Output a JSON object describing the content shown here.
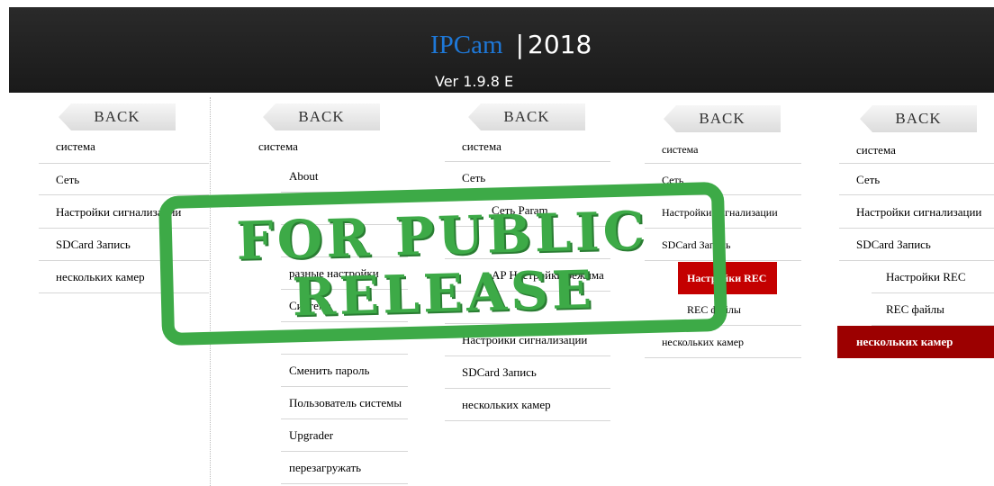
{
  "header": {
    "brand": "IPCam",
    "separator": "|",
    "year": "2018",
    "version": "Ver  1.9.8 E"
  },
  "back_label": "BACK",
  "panels": [
    {
      "top_item": "система",
      "rows": [
        "Сеть",
        "Настройки сигнализации",
        "SDCard Запись",
        "нескольких камер"
      ]
    },
    {
      "top_item": "система",
      "rows": [
        "About",
        "",
        "",
        "разные настройки",
        "Система",
        "",
        "Сменить пароль",
        "Пользователь системы",
        "Upgrader",
        "перезагружать"
      ]
    },
    {
      "top_item": "система",
      "rows": [
        "Сеть",
        "Сеть Param",
        "",
        "AP Настройки режима",
        "",
        "Настроики сигнализации",
        "SDCard Запись",
        "нескольких камер"
      ]
    },
    {
      "top_item": "система",
      "rows": [
        "Сеть",
        "Настройки сигнализации",
        "SDCard Запись",
        "Настройки REC",
        "REC файлы",
        "нескольких камер"
      ]
    },
    {
      "top_item": "система",
      "rows": [
        "Сеть",
        "Настройки сигнализации",
        "SDCard Запись",
        "Настройки REC",
        "REC файлы",
        "нескольких камер"
      ]
    }
  ],
  "stamp": {
    "line1": "FOR PUBLIC",
    "line2": "RELEASE"
  },
  "colors": {
    "stamp": "#3daa47",
    "active_red": "#c40000",
    "active_dark": "#9c0000",
    "brand": "#1e78d8"
  }
}
